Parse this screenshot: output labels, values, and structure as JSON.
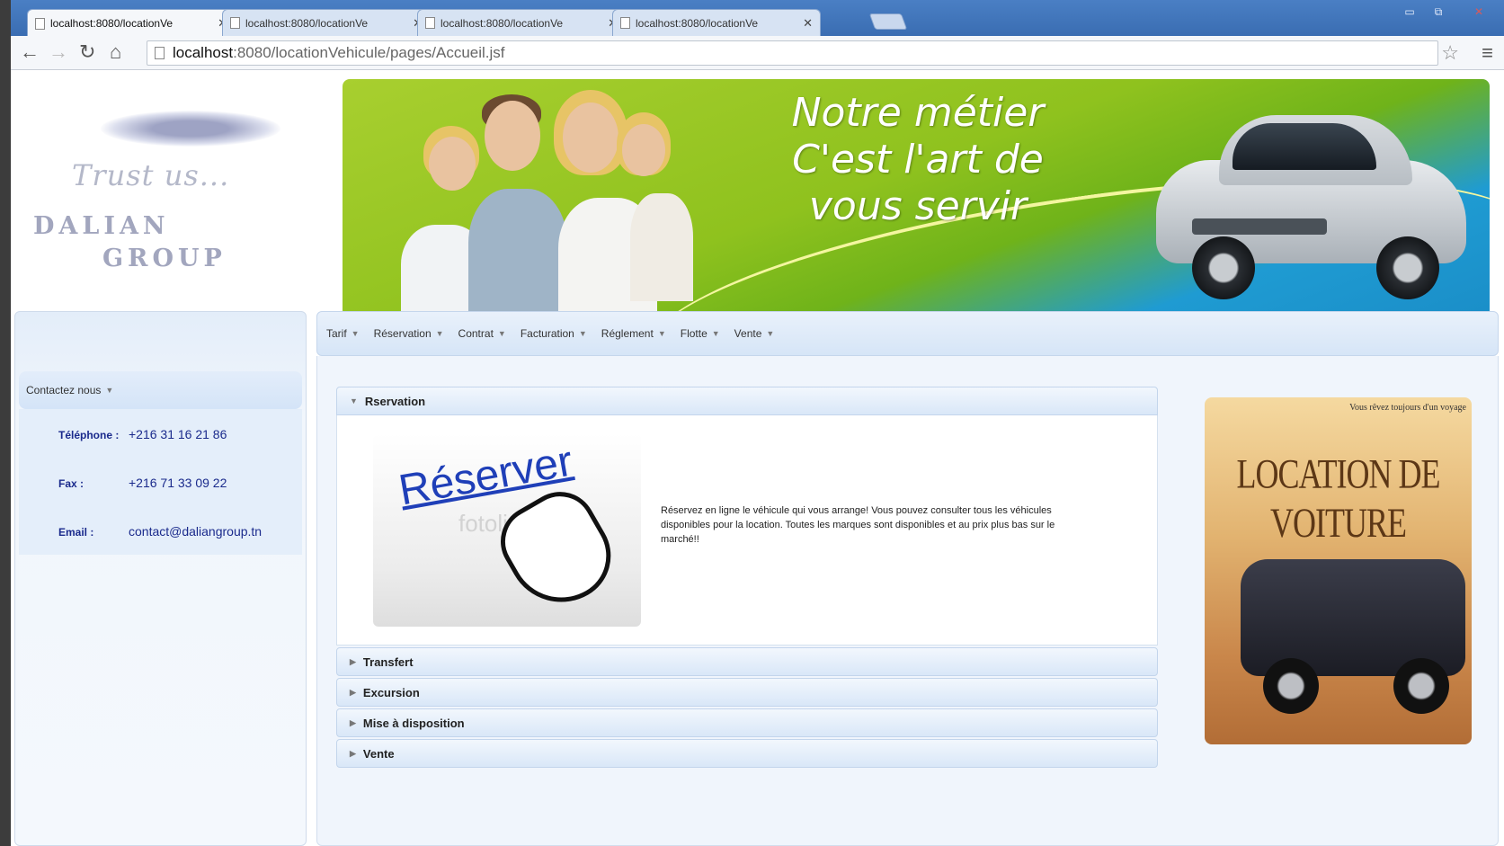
{
  "browser": {
    "tabs": [
      {
        "title": "localhost:8080/locationVe",
        "active": true
      },
      {
        "title": "localhost:8080/locationVe",
        "active": false
      },
      {
        "title": "localhost:8080/locationVe",
        "active": false
      },
      {
        "title": "localhost:8080/locationVe",
        "active": false
      }
    ],
    "url_host": "localhost",
    "url_rest": ":8080/locationVehicule/pages/Accueil.jsf"
  },
  "logo": {
    "tagline": "Trust us...",
    "line1": "DALIAN",
    "line2": "GROUP"
  },
  "banner": {
    "slogan_1": "Notre métier",
    "slogan_2": "C'est l'art de",
    "slogan_3": "vous servir"
  },
  "menu": {
    "items": [
      "Tarif",
      "Réservation",
      "Contrat",
      "Facturation",
      "Réglement",
      "Flotte",
      "Vente"
    ]
  },
  "contact": {
    "header": "Contactez nous",
    "phone_label": "Téléphone :",
    "phone": "+216 31 16 21 86",
    "fax_label": "Fax :",
    "fax": "+216 71 33 09 22",
    "email_label": "Email :",
    "email": "contact@daliangroup.tn"
  },
  "accordion": {
    "open_title": "Rservation",
    "image_word": "Réserver",
    "image_watermark": "fotolia",
    "description": "Réservez en ligne le véhicule qui vous arrange! Vous pouvez consulter tous les véhicules disponibles pour la location. Toutes les marques sont disponibles et au prix plus bas sur le marché!!",
    "closed": [
      "Transfert",
      "Excursion",
      "Mise à disposition",
      "Vente"
    ]
  },
  "poster": {
    "top_text": "Vous rêvez toujours d'un voyage",
    "title": "LOCATION DE VOITURE"
  },
  "colors": {
    "link_blue": "#1a2a8c",
    "accent_light_blue": "#d6e5f7"
  }
}
